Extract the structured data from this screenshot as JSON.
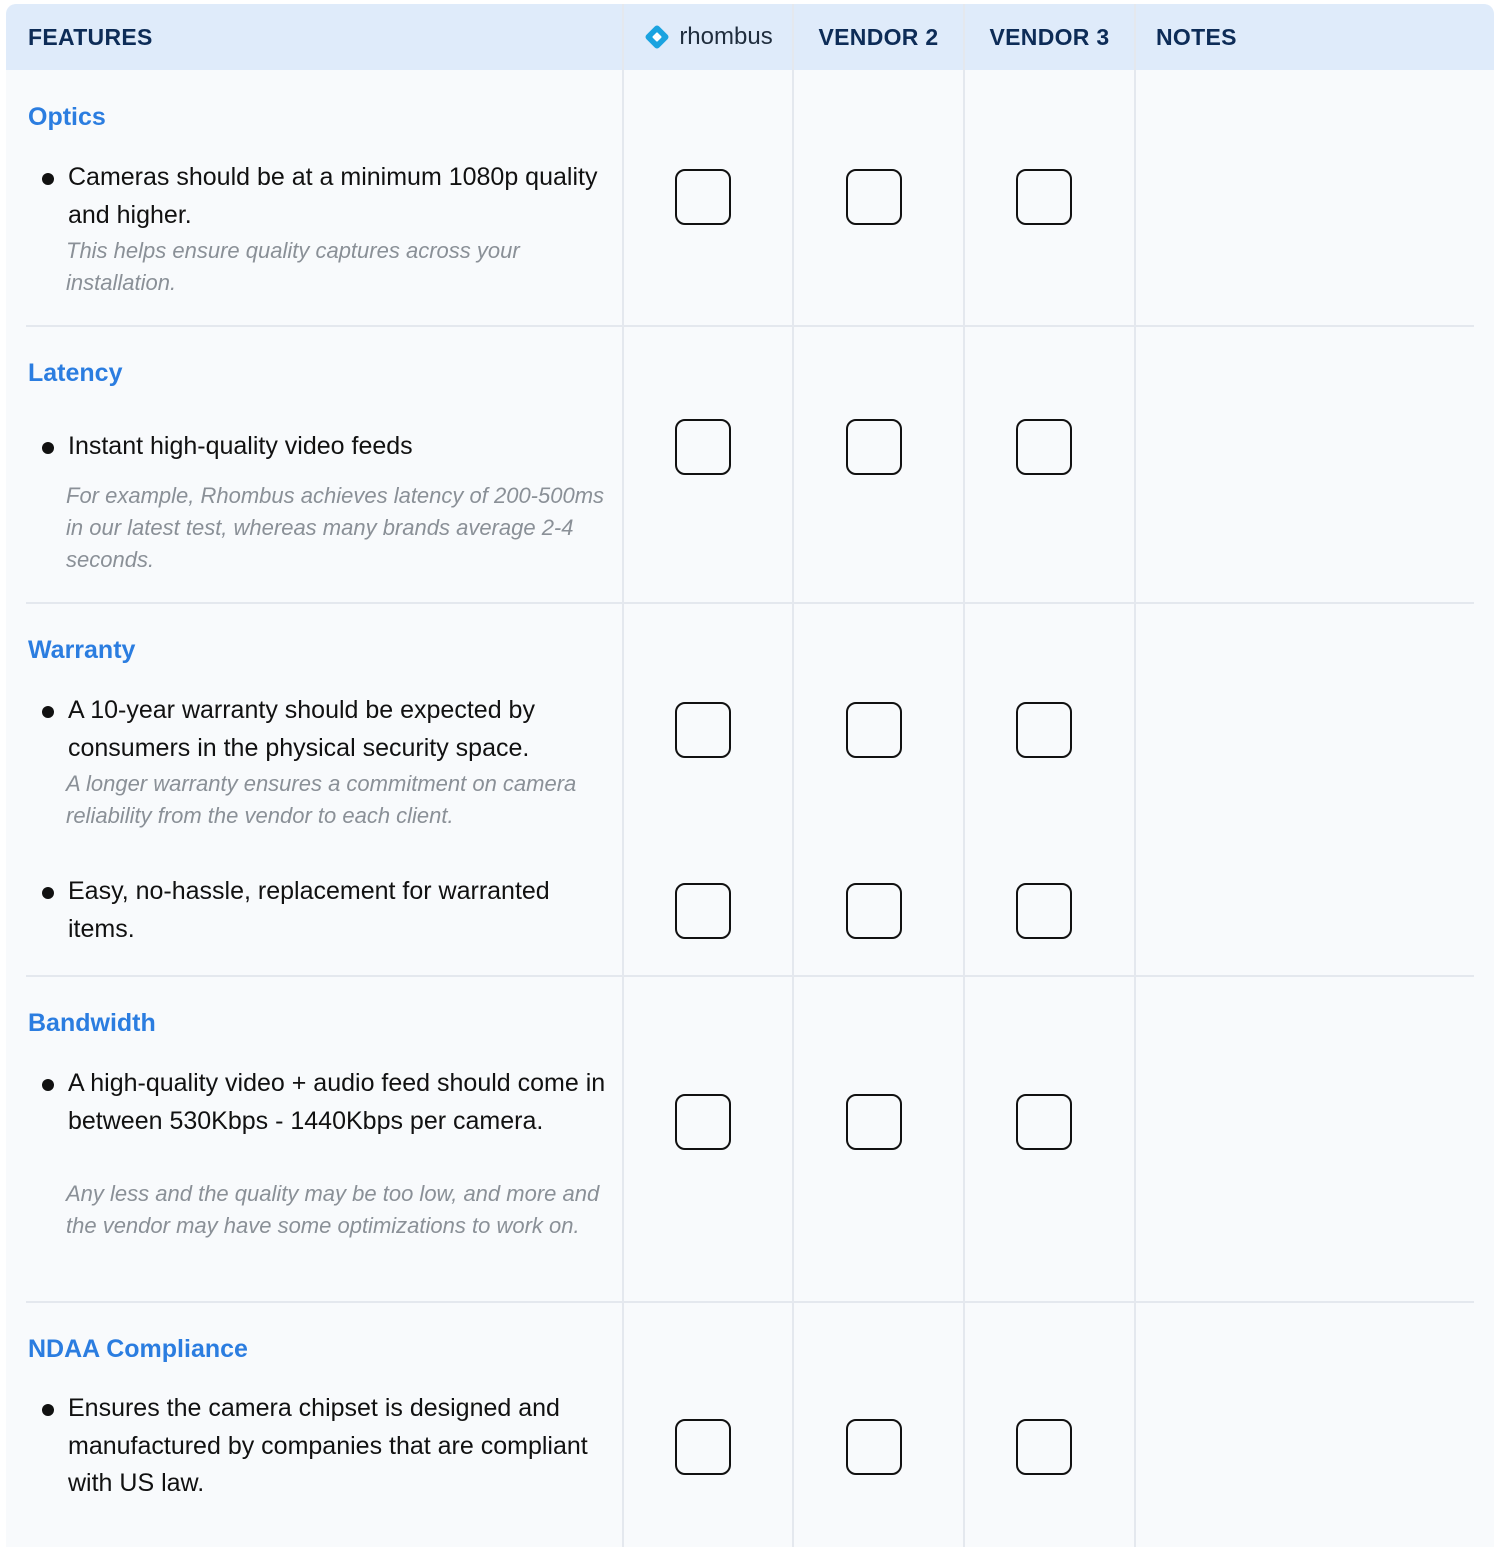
{
  "header": {
    "features": "FEATURES",
    "brand": "rhombus",
    "vendor2": "VENDOR 2",
    "vendor3": "VENDOR 3",
    "notes": "NOTES"
  },
  "colors": {
    "header_bg": "#dfebfa",
    "header_text": "#0d2c57",
    "section_title": "#2b7de0",
    "note_text": "#8a9097",
    "logo": "#1aa3e0"
  },
  "sections": [
    {
      "title": "Optics",
      "items": [
        {
          "text": "Cameras should be at a minimum 1080p quality and higher.",
          "note": "This helps ensure quality captures across your installation."
        }
      ]
    },
    {
      "title": "Latency",
      "items": [
        {
          "text": "Instant high-quality video feeds",
          "note": "For example, Rhombus achieves latency of 200-500ms in our latest test, whereas many brands average 2-4 seconds."
        }
      ]
    },
    {
      "title": "Warranty",
      "items": [
        {
          "text": "A 10-year warranty should be expected by consumers in the physical security space.",
          "note": "A longer warranty ensures a commitment on camera reliability from the vendor to each client."
        },
        {
          "text": "Easy, no-hassle, replacement for warranted items.",
          "note": ""
        }
      ]
    },
    {
      "title": "Bandwidth",
      "items": [
        {
          "text": "A high-quality video + audio feed should come in between  530Kbps - 1440Kbps per camera.",
          "note": "Any less and the quality may be too low, and more and the vendor may have some optimizations to work on."
        }
      ]
    },
    {
      "title": "NDAA Compliance",
      "items": [
        {
          "text": "Ensures the camera chipset is designed and manufactured by companies that are compliant with US law.",
          "note": ""
        }
      ]
    }
  ]
}
